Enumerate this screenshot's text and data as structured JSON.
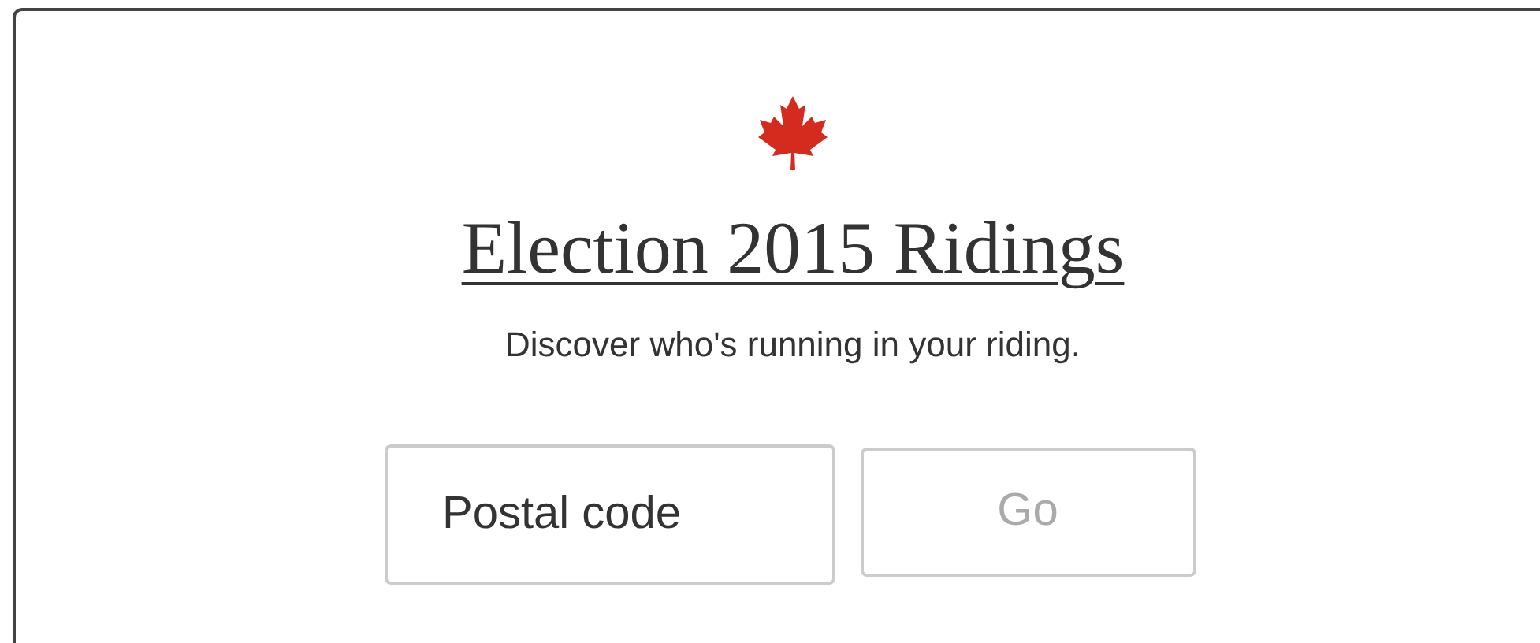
{
  "title": "Election 2015 Ridings",
  "subtitle": "Discover who's running in your riding.",
  "postal_code": {
    "placeholder": "Postal code"
  },
  "go_button": {
    "label": "Go",
    "disabled": true
  }
}
